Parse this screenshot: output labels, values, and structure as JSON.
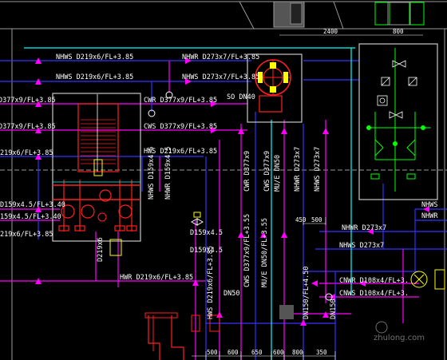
{
  "colors": {
    "background": "#000000",
    "magenta": "#ff00ff",
    "cyan": "#00ffff",
    "blue": "#3333ff",
    "red": "#ff2020",
    "green": "#00ff00",
    "yellow": "#ffff00",
    "white": "#ffffff",
    "gray": "#9a9a9a"
  },
  "labels": {
    "nhws_d219_385_a": "NHWS D219x6/FL+3.85",
    "nhws_d219_385_b": "NHWS D219x6/FL+3.85",
    "nhwr_d273_385": "NHWR D273x7/FL+3.85",
    "nhws_d273_385": "NHWS D273x7/FL+3.85",
    "so_dn40": "SO DN40",
    "d377_385_a": "D377x9/FL+3.85",
    "d377_385_b": "D377x9/FL+3.85",
    "cwr_d377": "CWR D377x9/FL+3.85",
    "cws_d377": "CWS D377x9/FL+3.85",
    "d219_385_left": "219x6/FL+3.85",
    "hws_d219": "HWS D219x6/FL+3.85",
    "hwr_d219": "HWR D219x6/FL+3.85",
    "d159_340_a": "D159x4.5/FL+3.40",
    "d159_340_b": "159x4.5/FL+3.40",
    "d219_385_c": "219x6/FL+3.85",
    "d159_45_a": "D159x4.5",
    "d159_45_b": "D159x4.5",
    "d219x6": "D219x6",
    "nhws_d159_v": "NHWS D159x4.5",
    "nhwr_d159_v": "NHWR D159x4.5",
    "hws_d219_v": "HWS D219x6/FL+3.85",
    "cws_d377_v": "CWS D377x9/FL+3.55",
    "mu_e_dn50_v": "MU/E DN50/FL+3.55",
    "cwr_d377_v": "CWR D377x9",
    "mu_e_dn50_v2": "MU/E DN50",
    "cws_d377_v2": "CWS D377x9",
    "nhwr_d273_v": "NHWR D273x7",
    "nhws_d273_v": "NHWS D273x7",
    "nhwr_d273_h": "NHWR D273x7",
    "nhws_d273_h": "NHWS D273x7",
    "cnwr_d108": "CNWR D108x4/FL+3.",
    "cnws_d108": "CNWS D108x4/FL+3.",
    "nhws_right": "NHWS",
    "nhwr_right": "NHWR",
    "dn50": "DN50",
    "dn150_fl": "DN150/FL+4.50",
    "dn150": "DN150",
    "dim_2400": "2400",
    "dim_800": "800",
    "dim_450": "450",
    "dim_500_mid": "500",
    "dim_500_bottom": "500",
    "dim_600_a": "600",
    "dim_650": "650",
    "dim_600_b": "600",
    "dim_800_bottom": "800",
    "dim_350": "350",
    "watermark": "zhulong.com"
  }
}
